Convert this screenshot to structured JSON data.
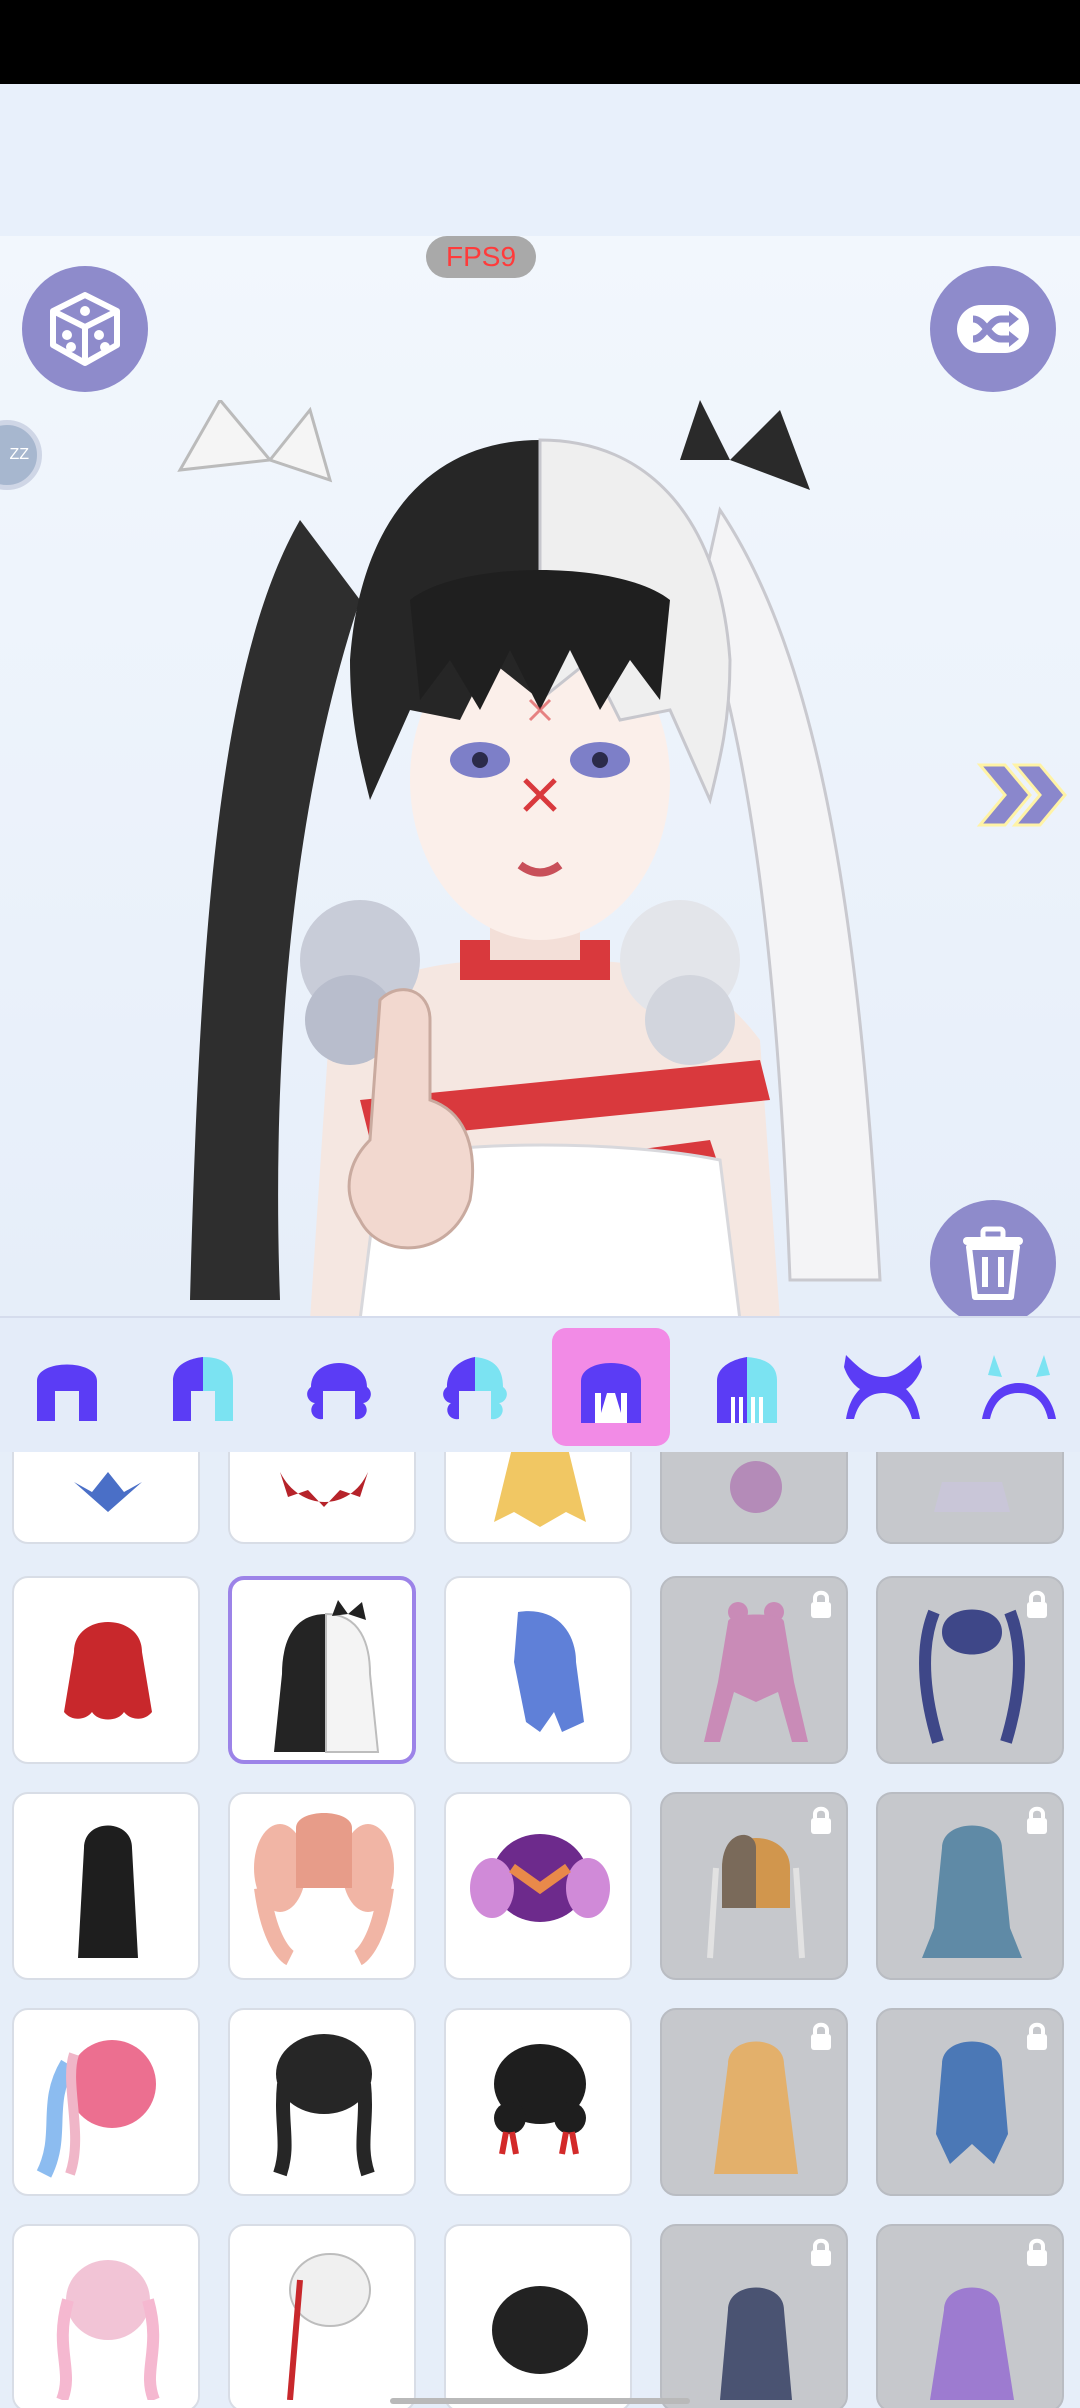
{
  "status_bar": {},
  "overlay": {
    "fps_label": "FPS9",
    "side_chip_label": "ZZ"
  },
  "buttons": {
    "random_icon": "dice-icon",
    "shuffle_icon": "shuffle-icon",
    "delete_icon": "trash-icon",
    "next_icon": "double-chevron-right-icon"
  },
  "category_tabs": [
    {
      "icon": "short-hair-icon",
      "active": false
    },
    {
      "icon": "short-hair-two-tone-icon",
      "active": false
    },
    {
      "icon": "curly-hair-icon",
      "active": false
    },
    {
      "icon": "curly-hair-two-tone-icon",
      "active": false
    },
    {
      "icon": "long-hair-icon",
      "active": true
    },
    {
      "icon": "long-hair-two-tone-icon",
      "active": false
    },
    {
      "icon": "horns-icon",
      "active": false
    },
    {
      "icon": "horns-two-tone-icon",
      "active": false
    }
  ],
  "colors": {
    "accent": "#9c83e8",
    "tab_active": "#f28be6",
    "button": "#8e8bcb",
    "icon_blue": "#5b3cf5"
  }
}
